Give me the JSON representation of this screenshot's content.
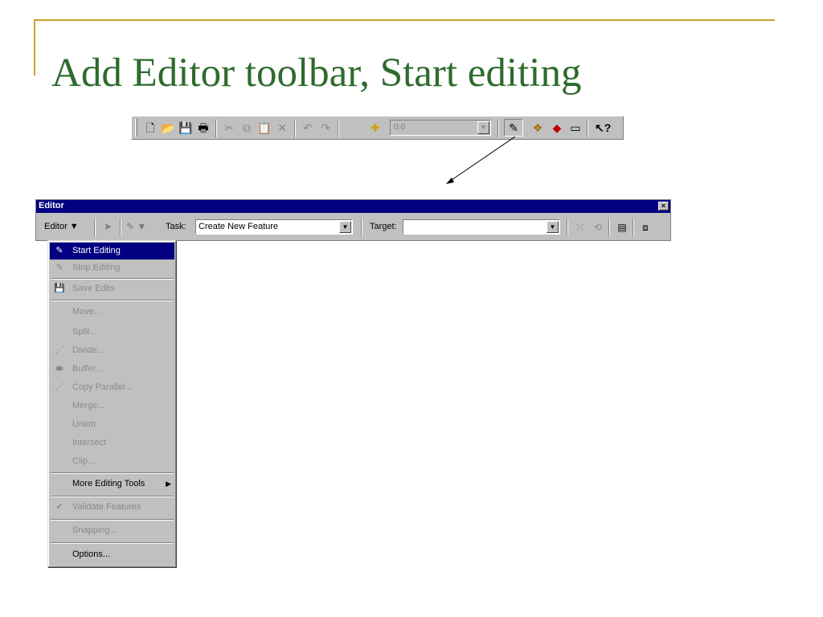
{
  "slide": {
    "title": "Add Editor toolbar, Start editing",
    "accent_color": "#c9a227",
    "title_color": "#2e6b2e"
  },
  "standard_toolbar": {
    "icons": [
      "new-document-icon",
      "open-folder-icon",
      "save-icon",
      "print-icon",
      "cut-icon",
      "copy-icon",
      "paste-icon",
      "delete-icon",
      "undo-icon",
      "redo-icon",
      "add-data-icon",
      "editor-toolbar-icon",
      "arcatalog-icon",
      "arctoolbox-icon",
      "command-line-icon",
      "whats-this-icon"
    ],
    "scale_value": "0:0"
  },
  "editor": {
    "title": "Editor",
    "close_glyph": "×",
    "menu_label": "Editor ▼",
    "task_label": "Task:",
    "task_value": "Create New Feature",
    "target_label": "Target:",
    "target_value": ""
  },
  "menu": {
    "items": [
      {
        "label": "Start Editing",
        "enabled": true,
        "highlighted": true,
        "icon": "start-editing-icon"
      },
      {
        "label": "Stop Editing",
        "enabled": false,
        "icon": "stop-editing-icon"
      },
      {
        "label": "Save Edits",
        "enabled": false,
        "icon": "save-edits-icon"
      },
      {
        "label": "Move...",
        "enabled": false
      },
      {
        "label": "Split...",
        "enabled": false
      },
      {
        "label": "Divide...",
        "enabled": false,
        "icon": "divide-icon"
      },
      {
        "label": "Buffer...",
        "enabled": false,
        "icon": "buffer-icon"
      },
      {
        "label": "Copy Parallel...",
        "enabled": false,
        "icon": "copy-parallel-icon"
      },
      {
        "label": "Merge...",
        "enabled": false
      },
      {
        "label": "Union",
        "enabled": false
      },
      {
        "label": "Intersect",
        "enabled": false
      },
      {
        "label": "Clip...",
        "enabled": false
      },
      {
        "label": "More Editing Tools",
        "enabled": true,
        "submenu": true
      },
      {
        "label": "Validate Features",
        "enabled": false,
        "icon": "validate-features-icon"
      },
      {
        "label": "Snapping...",
        "enabled": false
      },
      {
        "label": "Options...",
        "enabled": true
      }
    ]
  }
}
